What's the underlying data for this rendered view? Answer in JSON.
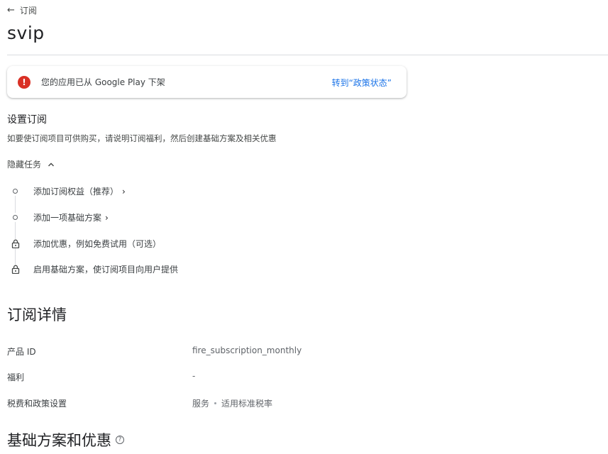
{
  "header": {
    "back_label": "订阅",
    "title": "svip"
  },
  "alert": {
    "message": "您的应用已从 Google Play 下架",
    "link_label": "转到“政策状态”",
    "icon": "error-icon",
    "color": "#d93025"
  },
  "setup": {
    "title": "设置订阅",
    "description": "如要使订阅项目可供购买，请说明订阅福利，然后创建基础方案及相关优惠",
    "toggle_label": "隐藏任务",
    "tasks": [
      {
        "label": "添加订阅权益（推荐）",
        "state": "open",
        "chevron": "›"
      },
      {
        "label": "添加一项基础方案",
        "state": "open",
        "chevron": "›"
      },
      {
        "label": "添加优惠，例如免费试用（可选）",
        "state": "locked"
      },
      {
        "label": "启用基础方案，使订阅项目向用户提供",
        "state": "locked"
      }
    ]
  },
  "details": {
    "title": "订阅详情",
    "rows": [
      {
        "label": "产品 ID",
        "value": "fire_subscription_monthly"
      },
      {
        "label": "福利",
        "value": "-"
      },
      {
        "label": "税费和政策设置",
        "value": "服务",
        "value2": "适用标准税率"
      }
    ]
  },
  "plans": {
    "title": "基础方案和优惠",
    "help_icon": "help-icon"
  },
  "colors": {
    "accent": "#1a73e8",
    "error": "#d93025",
    "divider": "#dadce0"
  }
}
